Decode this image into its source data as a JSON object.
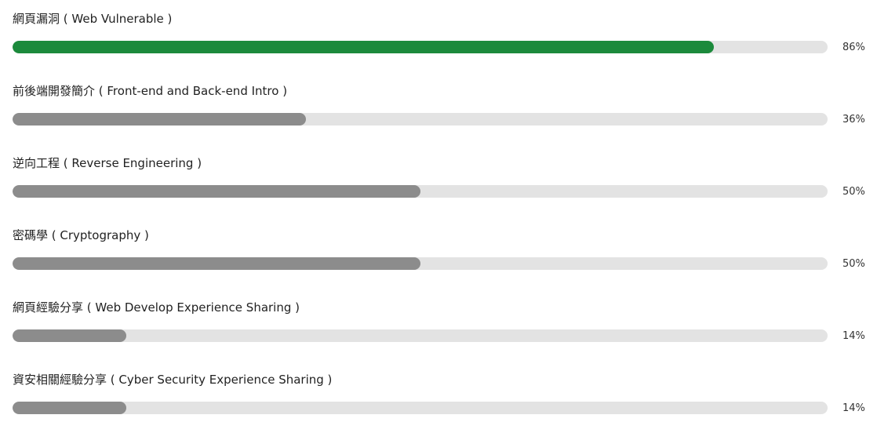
{
  "skills": [
    {
      "label": "網頁漏洞 ( Web Vulnerable )",
      "percent_text": "86%",
      "value": 86,
      "color": "#1c8a3c"
    },
    {
      "label": "前後端開發簡介 ( Front-end and Back-end Intro )",
      "percent_text": "36%",
      "value": 36,
      "color": "#8c8c8c"
    },
    {
      "label": "逆向工程 ( Reverse Engineering )",
      "percent_text": "50%",
      "value": 50,
      "color": "#8c8c8c"
    },
    {
      "label": "密碼學 ( Cryptography )",
      "percent_text": "50%",
      "value": 50,
      "color": "#8c8c8c"
    },
    {
      "label": "網頁經驗分享 ( Web Develop Experience Sharing )",
      "percent_text": "14%",
      "value": 14,
      "color": "#8c8c8c"
    },
    {
      "label": "資安相關經驗分享 ( Cyber Security Experience Sharing )",
      "percent_text": "14%",
      "value": 14,
      "color": "#8c8c8c"
    }
  ],
  "colors": {
    "track": "#e3e3e3",
    "active_fill": "#1c8a3c",
    "default_fill": "#8c8c8c"
  }
}
